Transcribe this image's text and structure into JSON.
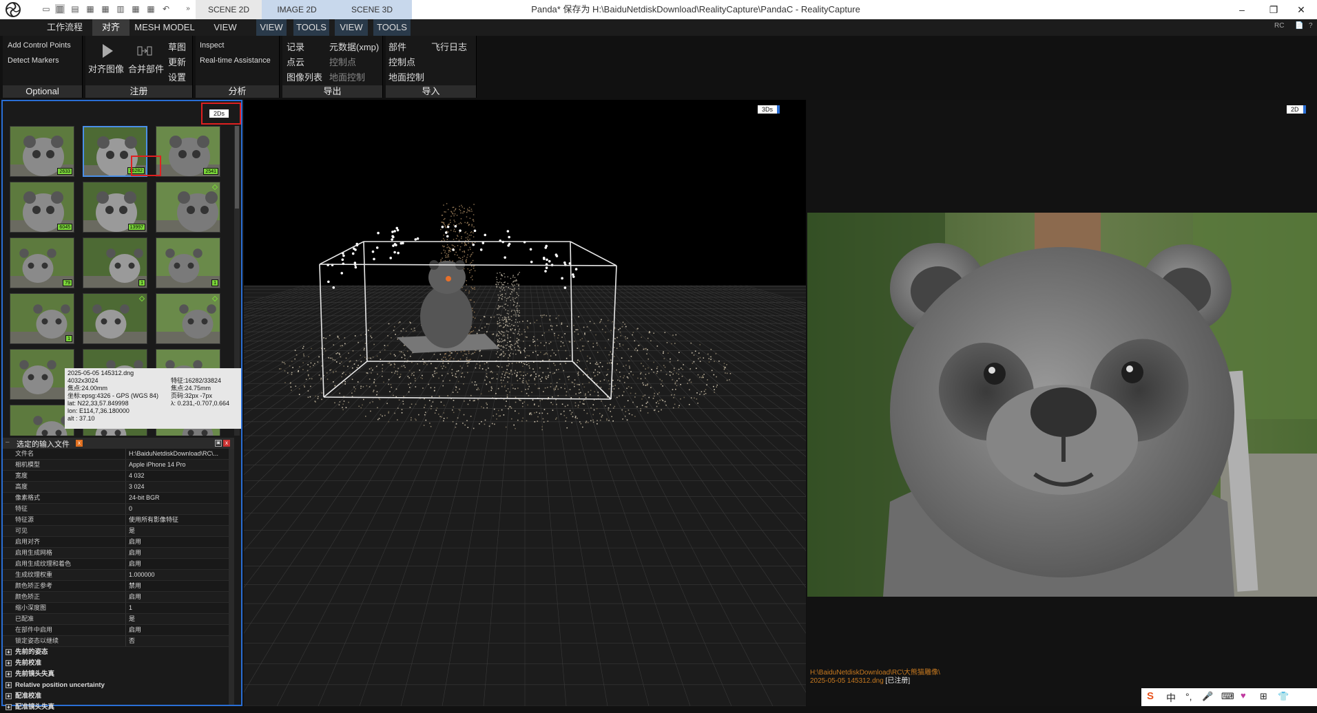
{
  "titlebar": {
    "tabs": [
      "SCENE 2D",
      "IMAGE 2D",
      "SCENE 3D"
    ],
    "title": "Panda* 保存为 H:\\BaiduNetdiskDownload\\RealityCapture\\PandaC - RealityCapture",
    "win_buttons": [
      "–",
      "❐",
      "✕"
    ]
  },
  "menubar": {
    "tabs": [
      "工作流程",
      "对齐",
      "MESH MODEL",
      "VIEW",
      "VIEW",
      "TOOLS",
      "VIEW",
      "TOOLS"
    ],
    "right": [
      "RC",
      "📄",
      "?"
    ]
  },
  "ribbon": {
    "optional": {
      "items": [
        "Add Control Points",
        "Detect Markers"
      ],
      "footer": "Optional"
    },
    "register": {
      "align": "对齐图像",
      "merge": "合并部件",
      "items": [
        "草图",
        "更新",
        "设置"
      ],
      "footer": "注册"
    },
    "analysis": {
      "items": [
        "Inspect",
        "Real-time Assistance"
      ],
      "footer": "分析"
    },
    "export": {
      "col1": [
        "记录",
        "点云",
        "图像列表"
      ],
      "col2": [
        "元数据(xmp)",
        "控制点",
        "地面控制"
      ],
      "footer": "导出"
    },
    "import": {
      "col1": [
        "部件",
        "控制点",
        "地面控制"
      ],
      "col2": [
        "飞行日志"
      ],
      "footer": "导入"
    }
  },
  "leftpanel": {
    "badge": "2Ds",
    "thumb_badges": [
      "2633",
      "16282",
      "2541",
      "6045",
      "13997",
      "",
      "79",
      "1",
      "1",
      "1",
      "",
      "",
      "",
      "",
      "",
      "",
      "",
      ""
    ],
    "tooltip": {
      "col1": [
        "2025-05-05 145312.dng",
        "4032x3024",
        "焦点:24.00mm",
        "坐标:epsg:4326 - GPS (WGS 84)",
        "lat: N22,33,57.849998",
        "lon: E114,7,36.180000",
        "alt : 37.10"
      ],
      "col2": [
        "特征:16282/33824",
        "焦点:24.75mm",
        "页码:32px  -7px",
        "λ: 0.231,-0.707,0.664"
      ]
    },
    "props_header": "选定的输入文件",
    "props": [
      {
        "k": "文件名",
        "v": "H:\\BaiduNetdiskDownload\\RC\\..."
      },
      {
        "k": "相机模型",
        "v": "Apple iPhone 14 Pro"
      },
      {
        "k": "宽度",
        "v": "4 032"
      },
      {
        "k": "高度",
        "v": "3 024"
      },
      {
        "k": "像素格式",
        "v": "24-bit BGR"
      },
      {
        "k": "特征",
        "v": "0"
      },
      {
        "k": "特征源",
        "v": "使用所有影像特征"
      },
      {
        "k": "可见",
        "v": "是"
      },
      {
        "k": "启用对齐",
        "v": "启用"
      },
      {
        "k": "启用生成网格",
        "v": "启用"
      },
      {
        "k": "启用生成纹理和着色",
        "v": "启用"
      },
      {
        "k": "生成纹理权重",
        "v": "1.000000"
      },
      {
        "k": "颜色矫正参考",
        "v": "禁用"
      },
      {
        "k": "颜色矫正",
        "v": "启用"
      },
      {
        "k": "缩小深度图",
        "v": "1"
      },
      {
        "k": "已配准",
        "v": "是"
      },
      {
        "k": "在部件中启用",
        "v": "启用"
      },
      {
        "k": "锁定姿态以继续",
        "v": "否"
      }
    ],
    "groups": [
      "先前的姿态",
      "先前校准",
      "先前镜头失真",
      "Relative position uncertainty",
      "配准校准",
      "配准镜头失真"
    ]
  },
  "view3d": {
    "badge": "3Ds"
  },
  "view2d": {
    "badge": "2D",
    "path": "H:\\BaiduNetdiskDownload\\RC\\大熊猫雕像\\",
    "filename": "2025-05-05 145312.dng",
    "status": "[已注册]"
  },
  "taskbar": {
    "items": [
      "S",
      "中",
      "°,",
      "🎤",
      "⌨",
      "♥",
      "⊞",
      "👕"
    ]
  },
  "colors": {
    "selection": "#2a6fd6",
    "highlight": "#e02020",
    "badge_green": "#7bd63a"
  }
}
